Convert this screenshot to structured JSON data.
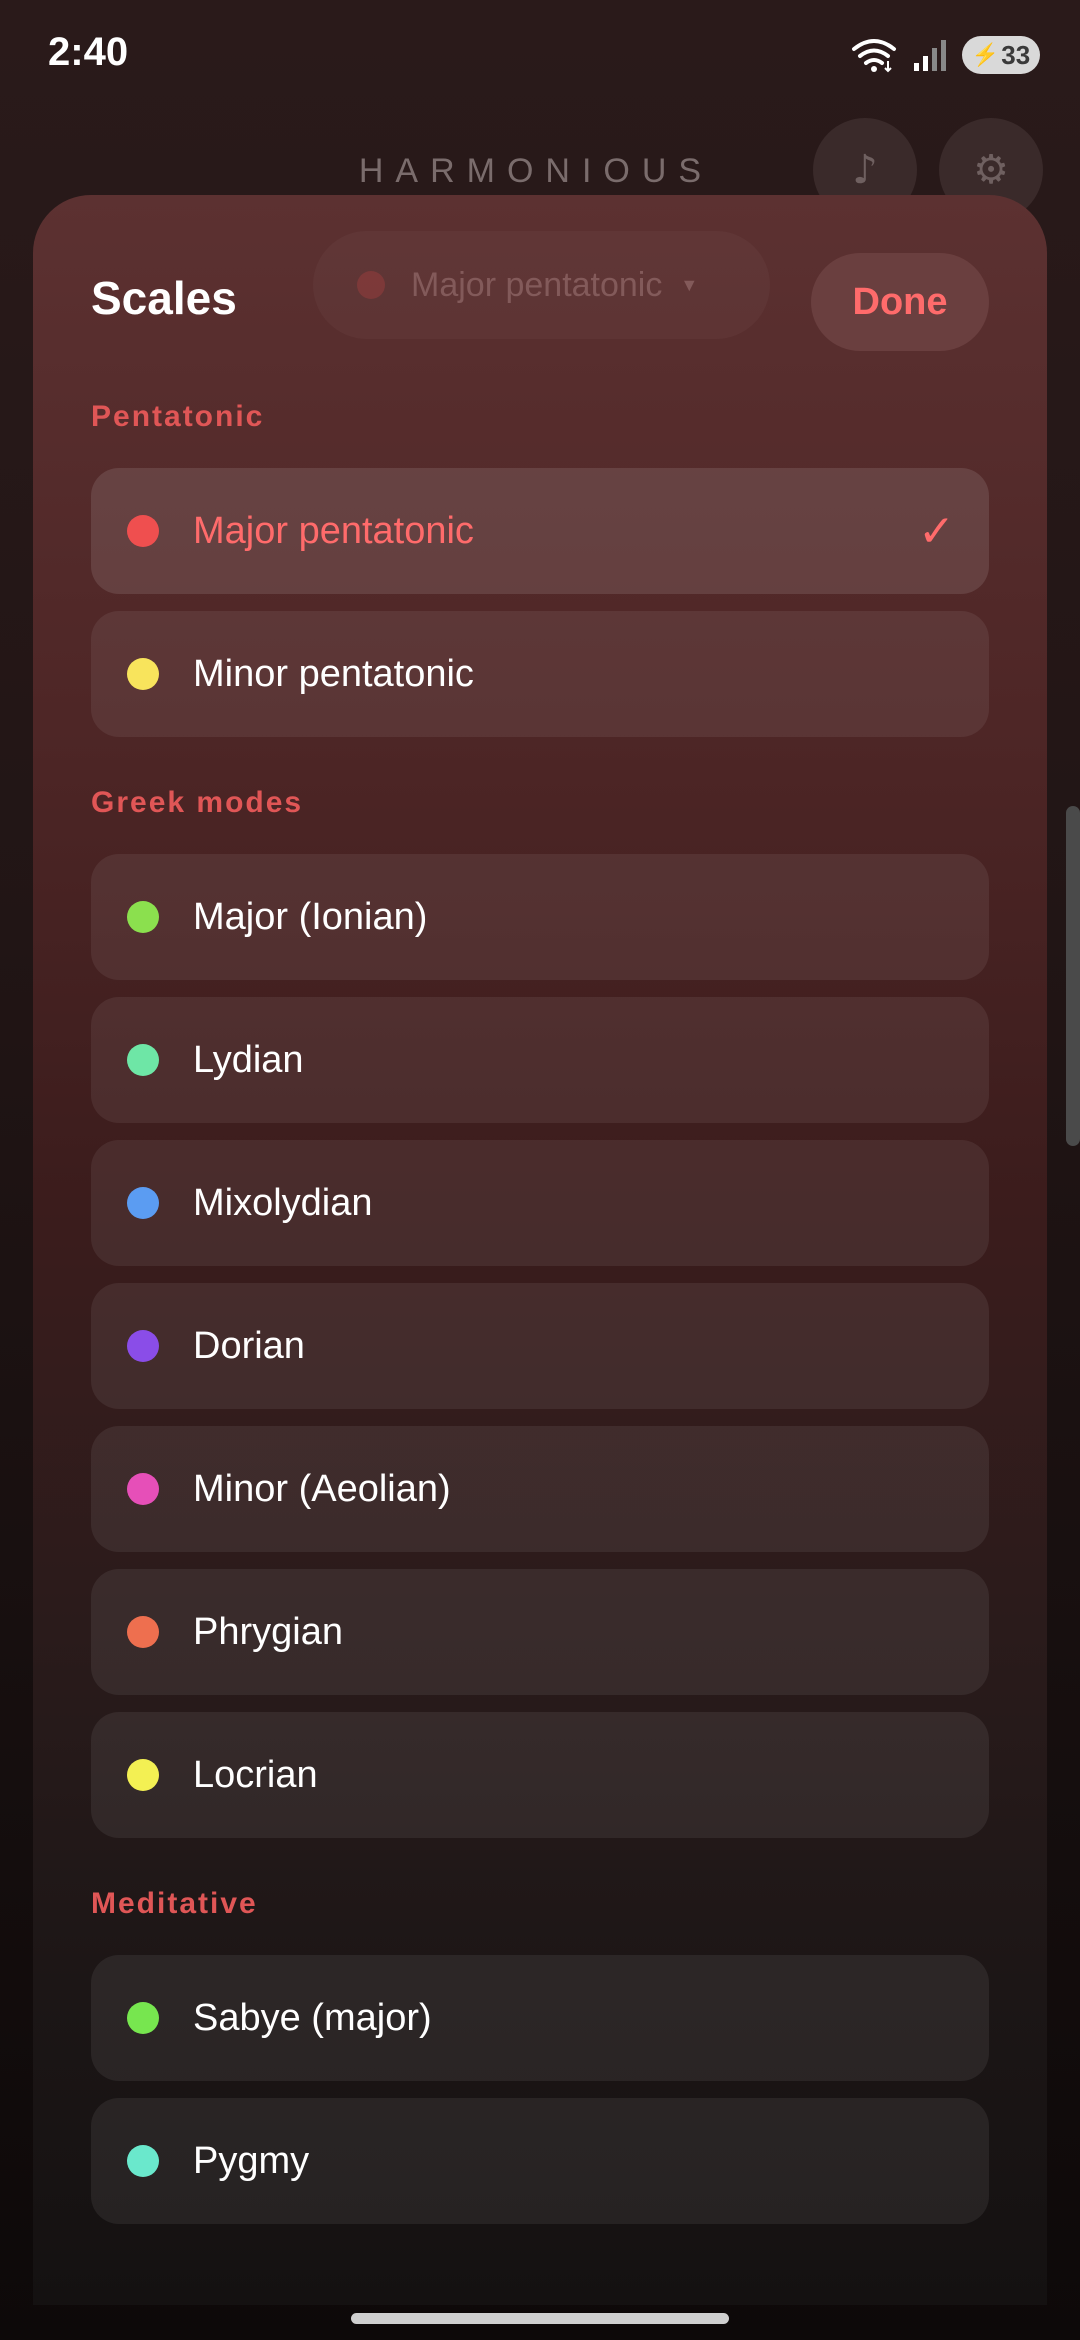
{
  "status_bar": {
    "time": "2:40",
    "battery": "33",
    "icons": [
      "wifi-icon",
      "signal-icon",
      "battery-charging-icon"
    ]
  },
  "app": {
    "title": "HARMONIOUS",
    "music_icon": "♪",
    "settings_icon": "⚙"
  },
  "sheet": {
    "title": "Scales",
    "current_selector": "Major pentatonic",
    "done_label": "Done",
    "check_mark": "✓",
    "sections": [
      {
        "heading": "Pentatonic",
        "items": [
          {
            "label": "Major pentatonic",
            "color": "#ef4f4f",
            "selected": true
          },
          {
            "label": "Minor pentatonic",
            "color": "#f8e45c",
            "selected": false
          }
        ]
      },
      {
        "heading": "Greek modes",
        "items": [
          {
            "label": "Major (Ionian)",
            "color": "#8be04e"
          },
          {
            "label": "Lydian",
            "color": "#6ee6a6"
          },
          {
            "label": "Mixolydian",
            "color": "#5b9cf2"
          },
          {
            "label": "Dorian",
            "color": "#8a4de8"
          },
          {
            "label": "Minor (Aeolian)",
            "color": "#e64fb8"
          },
          {
            "label": "Phrygian",
            "color": "#ee6f4f"
          },
          {
            "label": "Locrian",
            "color": "#f3f053"
          }
        ]
      },
      {
        "heading": "Meditative",
        "items": [
          {
            "label": "Sabye (major)",
            "color": "#77e64f"
          },
          {
            "label": "Pygmy",
            "color": "#6ae8cc"
          }
        ]
      }
    ]
  },
  "colors": {
    "accent": "#ff6b6b",
    "heading": "#e05656"
  }
}
